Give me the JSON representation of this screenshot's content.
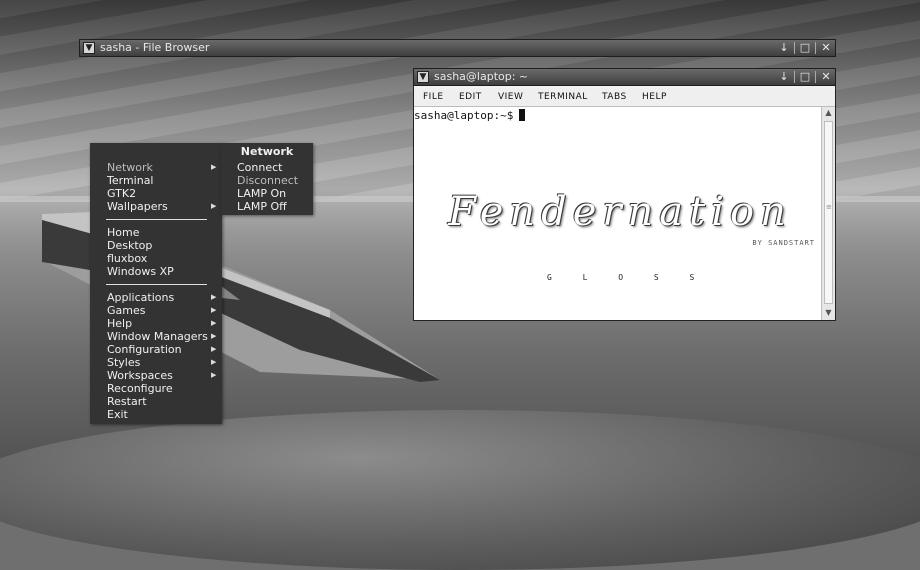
{
  "file_browser": {
    "title": "sasha - File Browser"
  },
  "terminal": {
    "title": "sasha@laptop: ~",
    "menu": [
      "File",
      "Edit",
      "View",
      "Terminal",
      "Tabs",
      "Help"
    ],
    "prompt": "sasha@laptop:~$",
    "logo": "Fendernation",
    "logo_byline": "BY SANDSTART",
    "gloss": "G L O S S"
  },
  "titlebar_buttons": {
    "iconify": "↓",
    "maximize": "□",
    "close": "✕"
  },
  "root_menu": {
    "group1": [
      "Network",
      "Terminal",
      "GTK2",
      "Wallpapers"
    ],
    "group2": [
      "Home",
      "Desktop",
      "fluxbox",
      "Windows XP"
    ],
    "group3": [
      "Applications",
      "Games",
      "Help",
      "Window Managers",
      "Configuration",
      "Styles",
      "Workspaces",
      "Reconfigure",
      "Restart",
      "Exit"
    ]
  },
  "network_menu": {
    "title": "Network",
    "items": [
      "Connect",
      "Disconnect",
      "LAMP On",
      "LAMP Off"
    ]
  },
  "colors": {
    "menu_bg": "#333333",
    "titlebar": "#4a4a4a",
    "terminal_bg": "#ffffff"
  }
}
